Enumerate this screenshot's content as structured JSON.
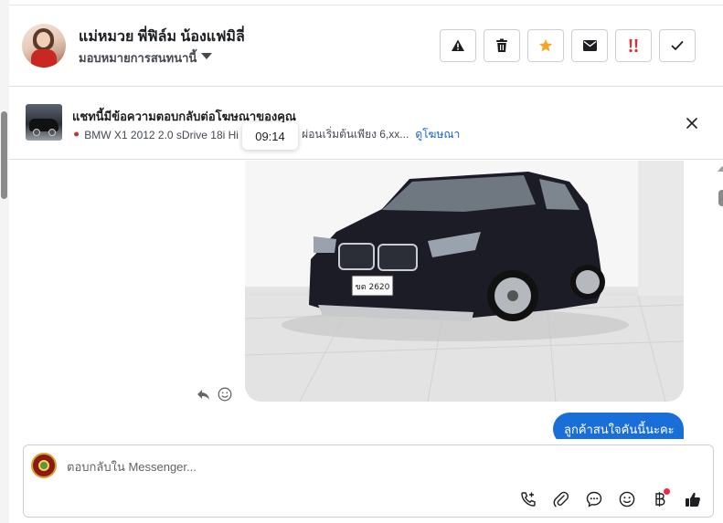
{
  "contact": {
    "name": "แม่หมวย พี่ฟิล์ม น้องแฟมิลี่",
    "assign_label": "มอบหมายการสนทนานี้"
  },
  "actions": [
    "report-icon",
    "trash-icon",
    "star-icon",
    "envelope-icon",
    "exclamation-icon",
    "check-icon"
  ],
  "ad": {
    "title": "แชทนี้มีข้อความตอบกลับต่อโฆษณาของคุณ",
    "subtitle_start": "BMW X1 2012 2.0 sDrive 18i Hi",
    "subtitle_end": "ผ่อนเริ่มต้นเพียง 6,xx...",
    "link": "ดูโฆษณา"
  },
  "tooltip_time": "09:14",
  "messages": [
    {
      "type": "image",
      "direction": "incoming",
      "subject": "car photo"
    },
    {
      "type": "text",
      "direction": "outgoing",
      "text": "ลูกค้าสนใจคันนี้นะคะ"
    }
  ],
  "composer": {
    "placeholder": "ตอบกลับใน Messenger...",
    "icons": [
      "call-add-icon",
      "attachment-icon",
      "saved-reply-icon",
      "emoji-icon",
      "payment-baht-icon",
      "thumbs-up-icon"
    ]
  },
  "colors": {
    "accent": "#1a6ed8",
    "star": "#f5a623",
    "alert": "#e02d2d",
    "link": "#1a63c7"
  }
}
